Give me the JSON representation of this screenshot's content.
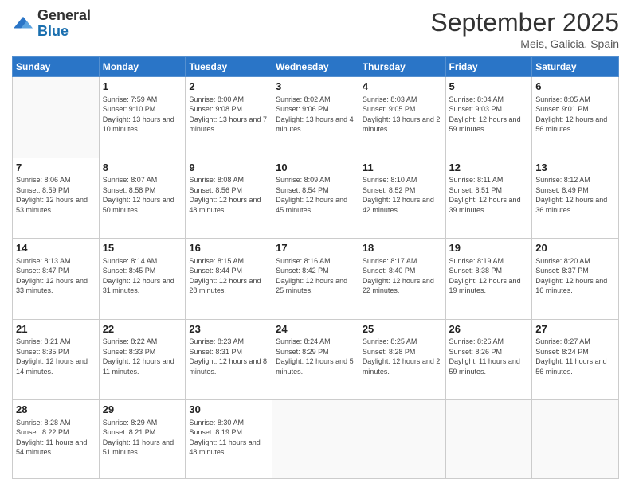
{
  "header": {
    "logo_general": "General",
    "logo_blue": "Blue",
    "month_title": "September 2025",
    "subtitle": "Meis, Galicia, Spain"
  },
  "weekdays": [
    "Sunday",
    "Monday",
    "Tuesday",
    "Wednesday",
    "Thursday",
    "Friday",
    "Saturday"
  ],
  "weeks": [
    [
      {
        "day": "",
        "sunrise": "",
        "sunset": "",
        "daylight": ""
      },
      {
        "day": "1",
        "sunrise": "Sunrise: 7:59 AM",
        "sunset": "Sunset: 9:10 PM",
        "daylight": "Daylight: 13 hours and 10 minutes."
      },
      {
        "day": "2",
        "sunrise": "Sunrise: 8:00 AM",
        "sunset": "Sunset: 9:08 PM",
        "daylight": "Daylight: 13 hours and 7 minutes."
      },
      {
        "day": "3",
        "sunrise": "Sunrise: 8:02 AM",
        "sunset": "Sunset: 9:06 PM",
        "daylight": "Daylight: 13 hours and 4 minutes."
      },
      {
        "day": "4",
        "sunrise": "Sunrise: 8:03 AM",
        "sunset": "Sunset: 9:05 PM",
        "daylight": "Daylight: 13 hours and 2 minutes."
      },
      {
        "day": "5",
        "sunrise": "Sunrise: 8:04 AM",
        "sunset": "Sunset: 9:03 PM",
        "daylight": "Daylight: 12 hours and 59 minutes."
      },
      {
        "day": "6",
        "sunrise": "Sunrise: 8:05 AM",
        "sunset": "Sunset: 9:01 PM",
        "daylight": "Daylight: 12 hours and 56 minutes."
      }
    ],
    [
      {
        "day": "7",
        "sunrise": "Sunrise: 8:06 AM",
        "sunset": "Sunset: 8:59 PM",
        "daylight": "Daylight: 12 hours and 53 minutes."
      },
      {
        "day": "8",
        "sunrise": "Sunrise: 8:07 AM",
        "sunset": "Sunset: 8:58 PM",
        "daylight": "Daylight: 12 hours and 50 minutes."
      },
      {
        "day": "9",
        "sunrise": "Sunrise: 8:08 AM",
        "sunset": "Sunset: 8:56 PM",
        "daylight": "Daylight: 12 hours and 48 minutes."
      },
      {
        "day": "10",
        "sunrise": "Sunrise: 8:09 AM",
        "sunset": "Sunset: 8:54 PM",
        "daylight": "Daylight: 12 hours and 45 minutes."
      },
      {
        "day": "11",
        "sunrise": "Sunrise: 8:10 AM",
        "sunset": "Sunset: 8:52 PM",
        "daylight": "Daylight: 12 hours and 42 minutes."
      },
      {
        "day": "12",
        "sunrise": "Sunrise: 8:11 AM",
        "sunset": "Sunset: 8:51 PM",
        "daylight": "Daylight: 12 hours and 39 minutes."
      },
      {
        "day": "13",
        "sunrise": "Sunrise: 8:12 AM",
        "sunset": "Sunset: 8:49 PM",
        "daylight": "Daylight: 12 hours and 36 minutes."
      }
    ],
    [
      {
        "day": "14",
        "sunrise": "Sunrise: 8:13 AM",
        "sunset": "Sunset: 8:47 PM",
        "daylight": "Daylight: 12 hours and 33 minutes."
      },
      {
        "day": "15",
        "sunrise": "Sunrise: 8:14 AM",
        "sunset": "Sunset: 8:45 PM",
        "daylight": "Daylight: 12 hours and 31 minutes."
      },
      {
        "day": "16",
        "sunrise": "Sunrise: 8:15 AM",
        "sunset": "Sunset: 8:44 PM",
        "daylight": "Daylight: 12 hours and 28 minutes."
      },
      {
        "day": "17",
        "sunrise": "Sunrise: 8:16 AM",
        "sunset": "Sunset: 8:42 PM",
        "daylight": "Daylight: 12 hours and 25 minutes."
      },
      {
        "day": "18",
        "sunrise": "Sunrise: 8:17 AM",
        "sunset": "Sunset: 8:40 PM",
        "daylight": "Daylight: 12 hours and 22 minutes."
      },
      {
        "day": "19",
        "sunrise": "Sunrise: 8:19 AM",
        "sunset": "Sunset: 8:38 PM",
        "daylight": "Daylight: 12 hours and 19 minutes."
      },
      {
        "day": "20",
        "sunrise": "Sunrise: 8:20 AM",
        "sunset": "Sunset: 8:37 PM",
        "daylight": "Daylight: 12 hours and 16 minutes."
      }
    ],
    [
      {
        "day": "21",
        "sunrise": "Sunrise: 8:21 AM",
        "sunset": "Sunset: 8:35 PM",
        "daylight": "Daylight: 12 hours and 14 minutes."
      },
      {
        "day": "22",
        "sunrise": "Sunrise: 8:22 AM",
        "sunset": "Sunset: 8:33 PM",
        "daylight": "Daylight: 12 hours and 11 minutes."
      },
      {
        "day": "23",
        "sunrise": "Sunrise: 8:23 AM",
        "sunset": "Sunset: 8:31 PM",
        "daylight": "Daylight: 12 hours and 8 minutes."
      },
      {
        "day": "24",
        "sunrise": "Sunrise: 8:24 AM",
        "sunset": "Sunset: 8:29 PM",
        "daylight": "Daylight: 12 hours and 5 minutes."
      },
      {
        "day": "25",
        "sunrise": "Sunrise: 8:25 AM",
        "sunset": "Sunset: 8:28 PM",
        "daylight": "Daylight: 12 hours and 2 minutes."
      },
      {
        "day": "26",
        "sunrise": "Sunrise: 8:26 AM",
        "sunset": "Sunset: 8:26 PM",
        "daylight": "Daylight: 11 hours and 59 minutes."
      },
      {
        "day": "27",
        "sunrise": "Sunrise: 8:27 AM",
        "sunset": "Sunset: 8:24 PM",
        "daylight": "Daylight: 11 hours and 56 minutes."
      }
    ],
    [
      {
        "day": "28",
        "sunrise": "Sunrise: 8:28 AM",
        "sunset": "Sunset: 8:22 PM",
        "daylight": "Daylight: 11 hours and 54 minutes."
      },
      {
        "day": "29",
        "sunrise": "Sunrise: 8:29 AM",
        "sunset": "Sunset: 8:21 PM",
        "daylight": "Daylight: 11 hours and 51 minutes."
      },
      {
        "day": "30",
        "sunrise": "Sunrise: 8:30 AM",
        "sunset": "Sunset: 8:19 PM",
        "daylight": "Daylight: 11 hours and 48 minutes."
      },
      {
        "day": "",
        "sunrise": "",
        "sunset": "",
        "daylight": ""
      },
      {
        "day": "",
        "sunrise": "",
        "sunset": "",
        "daylight": ""
      },
      {
        "day": "",
        "sunrise": "",
        "sunset": "",
        "daylight": ""
      },
      {
        "day": "",
        "sunrise": "",
        "sunset": "",
        "daylight": ""
      }
    ]
  ]
}
